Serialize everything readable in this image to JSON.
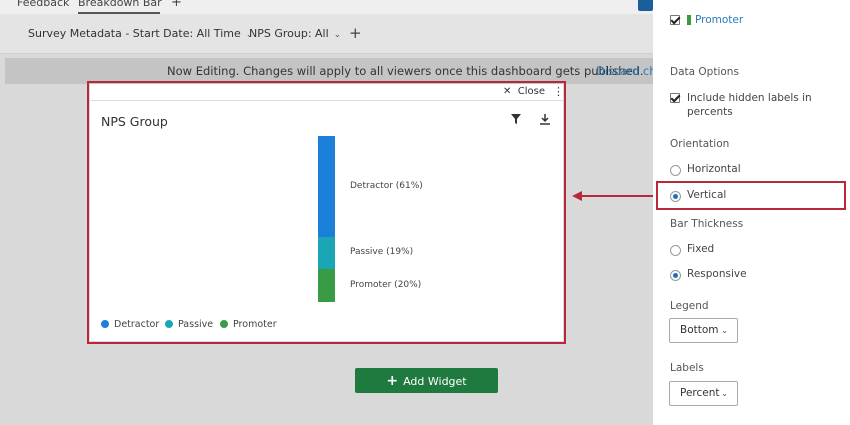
{
  "tabs": [
    {
      "label": "Feedback"
    },
    {
      "label": "Breakdown Bar",
      "active": true
    }
  ],
  "filters": [
    {
      "label": "Survey Metadata - Start Date: All Time"
    },
    {
      "label": "NPS Group: All"
    }
  ],
  "notice": {
    "text": "Now Editing. Changes will apply to all viewers once this dashboard gets published.",
    "link": "Discard cha"
  },
  "widget": {
    "close_label": "Close",
    "title": "NPS Group"
  },
  "chart_data": {
    "type": "bar",
    "orientation": "vertical",
    "stacked": true,
    "categories": [
      "Detractor",
      "Passive",
      "Promoter"
    ],
    "values": [
      61,
      19,
      20
    ],
    "labels": [
      "Detractor (61%)",
      "Passive (19%)",
      "Promoter (20%)"
    ],
    "colors": [
      "#1c7fd9",
      "#1aa6b5",
      "#3a9b45"
    ],
    "legend": {
      "position": "bottom",
      "items": [
        "Detractor",
        "Passive",
        "Promoter"
      ]
    }
  },
  "add_widget_label": "Add Widget",
  "panel": {
    "promoter_label": "Promoter",
    "promoter_color": "#3a9b45",
    "data_options": {
      "heading": "Data Options",
      "include_hidden_label": "Include hidden labels in percents",
      "include_hidden_label_line1": "Include hidden labels in",
      "include_hidden_label_line2": "percents",
      "checked": true
    },
    "orientation": {
      "heading": "Orientation",
      "options": [
        "Horizontal",
        "Vertical"
      ],
      "selected": "Vertical"
    },
    "bar_thickness": {
      "heading": "Bar Thickness",
      "options": [
        "Fixed",
        "Responsive"
      ],
      "selected": "Responsive"
    },
    "legend": {
      "heading": "Legend",
      "value": "Bottom"
    },
    "labels": {
      "heading": "Labels",
      "value": "Percent"
    }
  },
  "accent_color": "#b8283a"
}
